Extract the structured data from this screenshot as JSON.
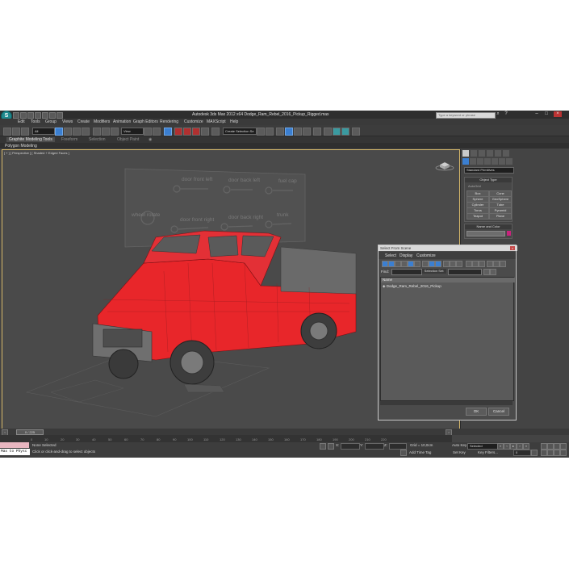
{
  "window": {
    "title": "Autodesk 3ds Max  2012 x64    Dodge_Ram_Rebel_2016_Pickup_Rigged.max",
    "search_placeholder": "Type a keyword or phrase",
    "logo": "3ds-max-logo"
  },
  "menu": [
    "Edit",
    "Tools",
    "Group",
    "Views",
    "Create",
    "Modifiers",
    "Animation",
    "Graph Editors",
    "Rendering",
    "Customize",
    "MAXScript",
    "Help"
  ],
  "toolbar": {
    "selection_filter": "All",
    "reference_coord": "View",
    "named_selection": "Create Selection Se"
  },
  "ribbon": {
    "tabs": [
      "Graphite Modeling Tools",
      "Freeform",
      "Selection",
      "Object Paint"
    ],
    "sub": "Polygon Modeling"
  },
  "viewport": {
    "label": "[ + ] [ Perspective ] [ Shaded + Edged Faces ]",
    "rig_labels": [
      "wheel rotate",
      "door front left",
      "door back left",
      "fuel cap",
      "door front right",
      "door back right",
      "trunk"
    ]
  },
  "command_panel": {
    "category_dropdown": "Standard Primitives",
    "object_type_title": "Object Type",
    "autogrid": "AutoGrid",
    "buttons": [
      "Box",
      "Cone",
      "Sphere",
      "GeoSphere",
      "Cylinder",
      "Tube",
      "Torus",
      "Pyramid",
      "Teapot",
      "Plane"
    ],
    "name_color_title": "Name and Color"
  },
  "dialog": {
    "title": "Select From Scene",
    "menu": [
      "Select",
      "Display",
      "Customize"
    ],
    "find_label": "Find:",
    "selection_set_label": "Selection Set:",
    "list_header": "Name",
    "items": [
      "Dodge_Ram_Rebel_2016_Pickup"
    ],
    "ok": "OK",
    "cancel": "Cancel"
  },
  "timeline": {
    "slider": "0 / 225",
    "ticks": [
      "0",
      "10",
      "20",
      "30",
      "40",
      "50",
      "60",
      "70",
      "80",
      "90",
      "100",
      "110",
      "120",
      "130",
      "140",
      "150",
      "160",
      "170",
      "180",
      "190",
      "200",
      "210",
      "220"
    ]
  },
  "status": {
    "maxscript_text": "Max to Physc",
    "selected": "None Selected",
    "prompt": "Click or click-and-drag to select objects",
    "x_label": "X:",
    "y_label": "Y:",
    "z_label": "Z:",
    "grid": "Grid = 10,0cm",
    "add_time_tag": "Add Time Tag",
    "auto_key": "Auto Key",
    "selected_dd": "Selected",
    "set_key": "Set Key",
    "key_filters": "Key Filters...",
    "frame": "0"
  },
  "colors": {
    "model_red": "#e8262a",
    "viewport_border": "#d8b96a",
    "object_color": "#c8237d"
  }
}
